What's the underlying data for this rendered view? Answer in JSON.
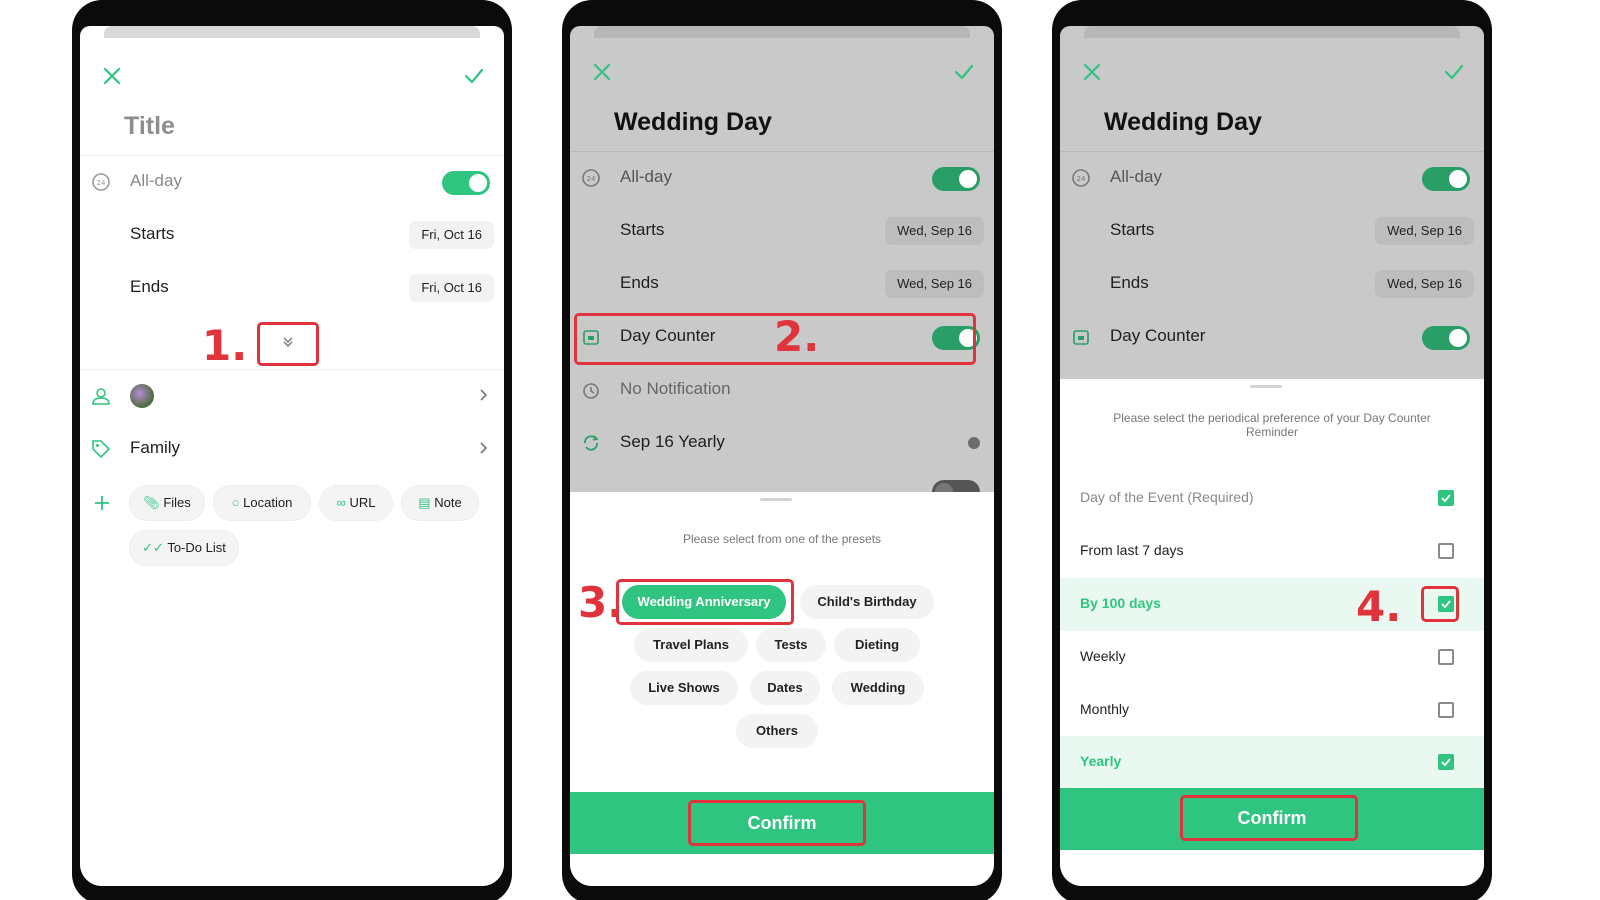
{
  "colors": {
    "accent": "#2fc47f",
    "annotation": "#e0333b",
    "dim_overlay": "#c9c9c9"
  },
  "screen1": {
    "title_placeholder": "Title",
    "allday_label": "All-day",
    "starts_label": "Starts",
    "starts_value": "Fri, Oct 16",
    "ends_label": "Ends",
    "ends_value": "Fri, Oct 16",
    "step": "1.",
    "tag_label": "Family",
    "attachments": [
      "Files",
      "Location",
      "URL",
      "Note",
      "To-Do List"
    ]
  },
  "screen2": {
    "title": "Wedding Day",
    "allday_label": "All-day",
    "starts_label": "Starts",
    "starts_value": "Wed, Sep 16",
    "ends_label": "Ends",
    "ends_value": "Wed, Sep 16",
    "day_counter_label": "Day Counter",
    "step_counter": "2.",
    "notification_label": "No Notification",
    "repeat_label": "Sep 16 Yearly",
    "presets_prompt": "Please select from one of the presets",
    "step_preset": "3.",
    "presets": [
      "Wedding Anniversary",
      "Child's Birthday",
      "Travel Plans",
      "Tests",
      "Dieting",
      "Live Shows",
      "Dates",
      "Wedding",
      "Others"
    ],
    "selected_preset": "Wedding Anniversary",
    "confirm_label": "Confirm"
  },
  "screen3": {
    "title": "Wedding Day",
    "allday_label": "All-day",
    "starts_label": "Starts",
    "starts_value": "Wed, Sep 16",
    "ends_label": "Ends",
    "ends_value": "Wed, Sep 16",
    "day_counter_label": "Day Counter",
    "prompt": "Please select the periodical preference of your Day Counter Reminder",
    "step": "4.",
    "options": [
      {
        "label": "Day of the Event (Required)",
        "checked": true
      },
      {
        "label": "From last 7 days",
        "checked": false
      },
      {
        "label": "By 100 days",
        "checked": true
      },
      {
        "label": "Weekly",
        "checked": false
      },
      {
        "label": "Monthly",
        "checked": false
      },
      {
        "label": "Yearly",
        "checked": true
      }
    ],
    "confirm_label": "Confirm"
  }
}
